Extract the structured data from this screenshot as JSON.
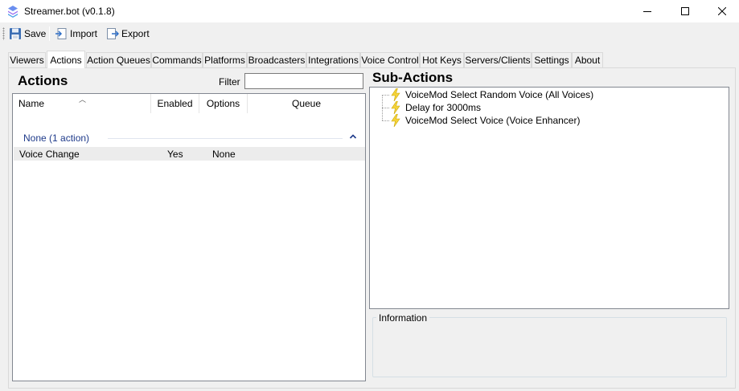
{
  "window": {
    "title": "Streamer.bot (v0.1.8)"
  },
  "toolbar": {
    "save_label": "Save",
    "import_label": "Import",
    "export_label": "Export"
  },
  "tabs": [
    {
      "label": "Viewers"
    },
    {
      "label": "Actions",
      "active": true
    },
    {
      "label": "Action Queues"
    },
    {
      "label": "Commands"
    },
    {
      "label": "Platforms"
    },
    {
      "label": "Broadcasters"
    },
    {
      "label": "Integrations"
    },
    {
      "label": "Voice Control"
    },
    {
      "label": "Hot Keys"
    },
    {
      "label": "Servers/Clients"
    },
    {
      "label": "Settings"
    },
    {
      "label": "About"
    }
  ],
  "actions_panel": {
    "title": "Actions",
    "filter_label": "Filter",
    "filter_value": "",
    "columns": [
      "Name",
      "Enabled",
      "Options",
      "Queue"
    ],
    "group": "None (1 action)",
    "rows": [
      {
        "name": "Voice Change",
        "enabled": "Yes",
        "options": "None",
        "queue": ""
      }
    ]
  },
  "sub_actions_panel": {
    "title": "Sub-Actions",
    "items": [
      {
        "label": "VoiceMod Select Random Voice (All Voices)",
        "icon": "lightning-icon"
      },
      {
        "label": "Delay for 3000ms",
        "icon": "lightning-icon"
      },
      {
        "label": "VoiceMod Select Voice (Voice Enhancer)",
        "icon": "lightning-icon"
      }
    ]
  },
  "information_panel": {
    "label": "Information"
  },
  "colors": {
    "group_text": "#1e3a8a",
    "bolt_fill": "#f5d33a",
    "selected_row": "#ececec"
  }
}
